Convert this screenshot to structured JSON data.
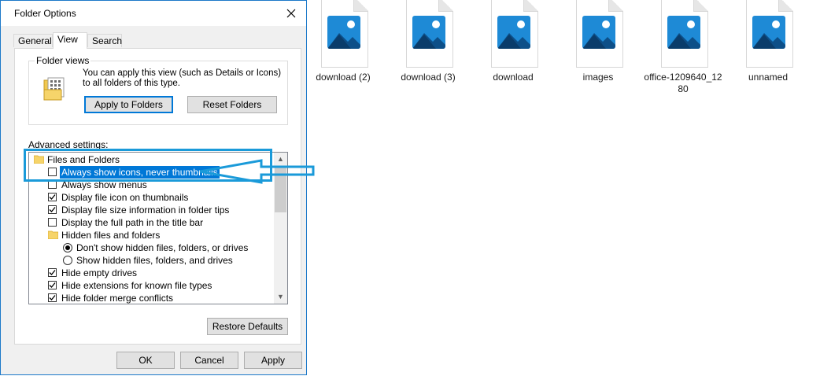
{
  "files": [
    {
      "name": "download (2)"
    },
    {
      "name": "download (3)"
    },
    {
      "name": "download"
    },
    {
      "name": "images"
    },
    {
      "name": "office-1209640_1280"
    },
    {
      "name": "unnamed"
    }
  ],
  "dialog": {
    "title": "Folder Options",
    "close_icon": "close-icon",
    "tabs": [
      {
        "label": "General",
        "active": false
      },
      {
        "label": "View",
        "active": true
      },
      {
        "label": "Search",
        "active": false
      }
    ],
    "folder_views": {
      "label": "Folder views",
      "description": "You can apply this view (such as Details or Icons) to all folders of this type.",
      "apply_button": "Apply to Folders",
      "reset_button": "Reset Folders"
    },
    "advanced": {
      "label": "Advanced settings:",
      "items": [
        {
          "type": "folder",
          "label": "Files and Folders"
        },
        {
          "type": "checkbox",
          "label": "Always show icons, never thumbnails",
          "checked": false,
          "selected": true
        },
        {
          "type": "checkbox",
          "label": "Always show menus",
          "checked": false
        },
        {
          "type": "checkbox",
          "label": "Display file icon on thumbnails",
          "checked": true
        },
        {
          "type": "checkbox",
          "label": "Display file size information in folder tips",
          "checked": true
        },
        {
          "type": "checkbox",
          "label": "Display the full path in the title bar",
          "checked": false
        },
        {
          "type": "folder",
          "label": "Hidden files and folders",
          "indent": true
        },
        {
          "type": "radio",
          "label": "Don't show hidden files, folders, or drives",
          "checked": true
        },
        {
          "type": "radio",
          "label": "Show hidden files, folders, and drives",
          "checked": false
        },
        {
          "type": "checkbox",
          "label": "Hide empty drives",
          "checked": true
        },
        {
          "type": "checkbox",
          "label": "Hide extensions for known file types",
          "checked": true
        },
        {
          "type": "checkbox",
          "label": "Hide folder merge conflicts",
          "checked": true
        }
      ]
    },
    "restore_button": "Restore Defaults",
    "ok_button": "OK",
    "cancel_button": "Cancel",
    "apply_button": "Apply"
  },
  "colors": {
    "accent": "#0078d7",
    "annotation": "#1a9ad9",
    "thumb_blue": "#1e8ad6"
  }
}
